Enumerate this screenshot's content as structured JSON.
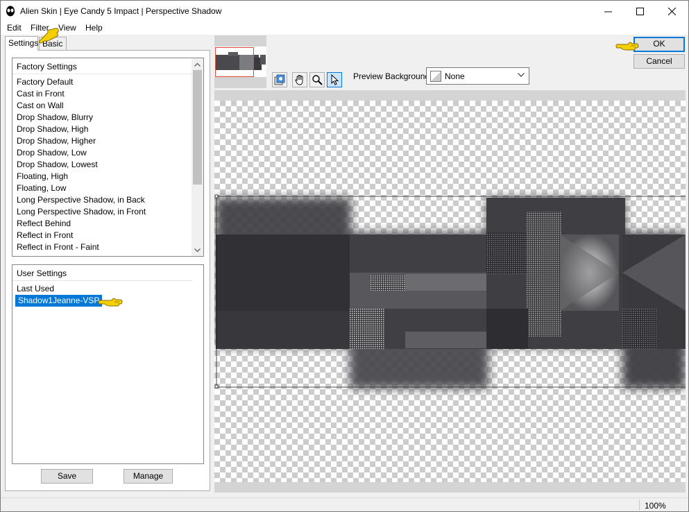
{
  "window": {
    "title": "Alien Skin | Eye Candy 5 Impact | Perspective Shadow"
  },
  "menu": [
    "Edit",
    "Filter",
    "View",
    "Help"
  ],
  "tabs": [
    "Settings",
    "Basic"
  ],
  "factory_settings": {
    "header": "Factory Settings",
    "items": [
      "Factory Default",
      "Cast in Front",
      "Cast on Wall",
      "Drop Shadow, Blurry",
      "Drop Shadow, High",
      "Drop Shadow, Higher",
      "Drop Shadow, Low",
      "Drop Shadow, Lowest",
      "Floating, High",
      "Floating, Low",
      "Long Perspective Shadow, in Back",
      "Long Perspective Shadow, in Front",
      "Reflect Behind",
      "Reflect in Front",
      "Reflect in Front - Faint"
    ]
  },
  "user_settings": {
    "header": "User Settings",
    "items": [
      "Last Used",
      "Shadow1Jeanne-VSP"
    ],
    "selected": "Shadow1Jeanne-VSP"
  },
  "buttons": {
    "save": "Save",
    "manage": "Manage",
    "ok": "OK",
    "cancel": "Cancel"
  },
  "toolbar": {
    "tools": [
      "preview-toggle-icon",
      "hand-icon",
      "zoom-icon",
      "arrow-pointer-icon"
    ],
    "active_tool": "arrow-pointer-icon",
    "preview_background_label": "Preview Background:",
    "preview_background_value": "None"
  },
  "status": {
    "zoom": "100%"
  },
  "colors": {
    "selection": "#0078d7",
    "thumb_rect": "#e8453c",
    "pointer_hand": "#f5d000"
  }
}
